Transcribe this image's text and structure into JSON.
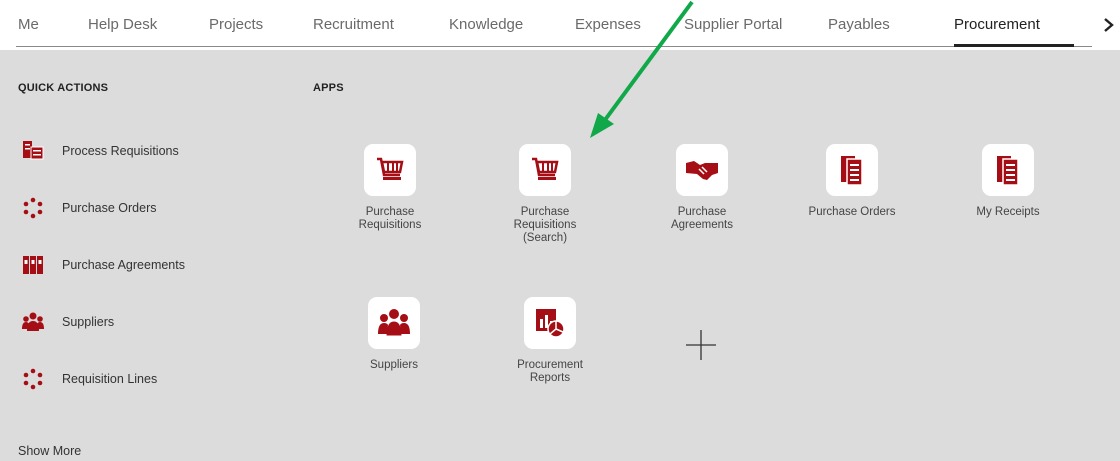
{
  "nav": {
    "tabs": [
      {
        "label": "Me"
      },
      {
        "label": "Help Desk"
      },
      {
        "label": "Projects"
      },
      {
        "label": "Recruitment"
      },
      {
        "label": "Knowledge"
      },
      {
        "label": "Expenses"
      },
      {
        "label": "Supplier Portal"
      },
      {
        "label": "Payables"
      },
      {
        "label": "Procurement"
      }
    ],
    "active_tab": "Procurement",
    "next_icon": "chevron-right-icon"
  },
  "quick_actions": {
    "title": "QUICK ACTIONS",
    "items": [
      {
        "label": "Process Requisitions",
        "icon": "process-requisitions-icon"
      },
      {
        "label": "Purchase Orders",
        "icon": "purchase-orders-icon"
      },
      {
        "label": "Purchase Agreements",
        "icon": "purchase-agreements-icon"
      },
      {
        "label": "Suppliers",
        "icon": "suppliers-icon"
      },
      {
        "label": "Requisition Lines",
        "icon": "requisition-lines-icon"
      }
    ],
    "show_more": "Show More"
  },
  "apps": {
    "title": "APPS",
    "items": [
      {
        "label": "Purchase Requisitions",
        "icon": "cart-icon"
      },
      {
        "label": "Purchase Requisitions (Search)",
        "icon": "cart-icon"
      },
      {
        "label": "Purchase Agreements",
        "icon": "handshake-icon"
      },
      {
        "label": "Purchase Orders",
        "icon": "document-icon"
      },
      {
        "label": "My Receipts",
        "icon": "document-icon"
      },
      {
        "label": "Suppliers",
        "icon": "people-icon"
      },
      {
        "label": "Procurement Reports",
        "icon": "report-icon"
      }
    ],
    "add_icon": "plus-icon"
  },
  "colors": {
    "accent": "#a50e14",
    "background": "#dcdcdc",
    "arrow": "#11a84a"
  }
}
